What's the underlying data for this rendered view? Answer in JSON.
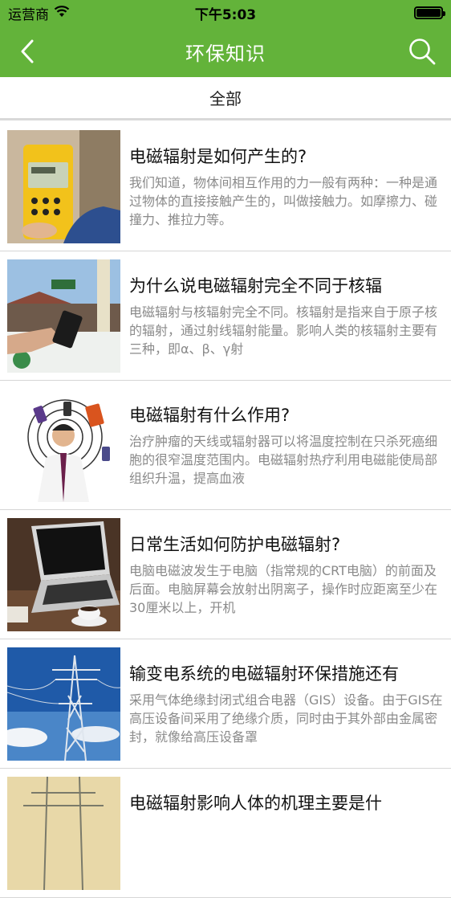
{
  "status_bar": {
    "carrier": "运营商",
    "time": "下午5:03"
  },
  "nav": {
    "title": "环保知识",
    "back_icon": "chevron-left-icon",
    "search_icon": "search-icon"
  },
  "filter": {
    "label": "全部"
  },
  "colors": {
    "brand_green": "#63b33a",
    "title_text": "#111111",
    "desc_text": "#8a8a8a",
    "divider": "#d6d6d6"
  },
  "articles": [
    {
      "title": "电磁辐射是如何产生的?",
      "desc": "我们知道，物体间相互作用的力一般有两种：一种是通过物体的直接接触产生的，叫做接触力。如摩擦力、碰撞力、推拉力等。"
    },
    {
      "title": "为什么说电磁辐射完全不同于核辐",
      "desc": "电磁辐射与核辐射完全不同。核辐射是指来自于原子核的辐射，通过射线辐射能量。影响人类的核辐射主要有三种，即α、β、γ射"
    },
    {
      "title": "电磁辐射有什么作用?",
      "desc": "治疗肿瘤的天线或辐射器可以将温度控制在只杀死癌细胞的很窄温度范围内。电磁辐射热疗利用电磁能使局部组织升温，提高血液"
    },
    {
      "title": "日常生活如何防护电磁辐射?",
      "desc": "电脑电磁波发生于电脑（指常规的CRT电脑）的前面及后面。电脑屏幕会放射出阴离子，操作时应距离至少在30厘米以上，开机"
    },
    {
      "title": "输变电系统的电磁辐射环保措施还有",
      "desc": "采用气体绝缘封闭式组合电器（GIS）设备。由于GIS在高压设备间采用了绝缘介质，同时由于其外部由金属密封，就像给高压设备罩"
    },
    {
      "title": "电磁辐射影响人体的机理主要是什",
      "desc": ""
    }
  ]
}
